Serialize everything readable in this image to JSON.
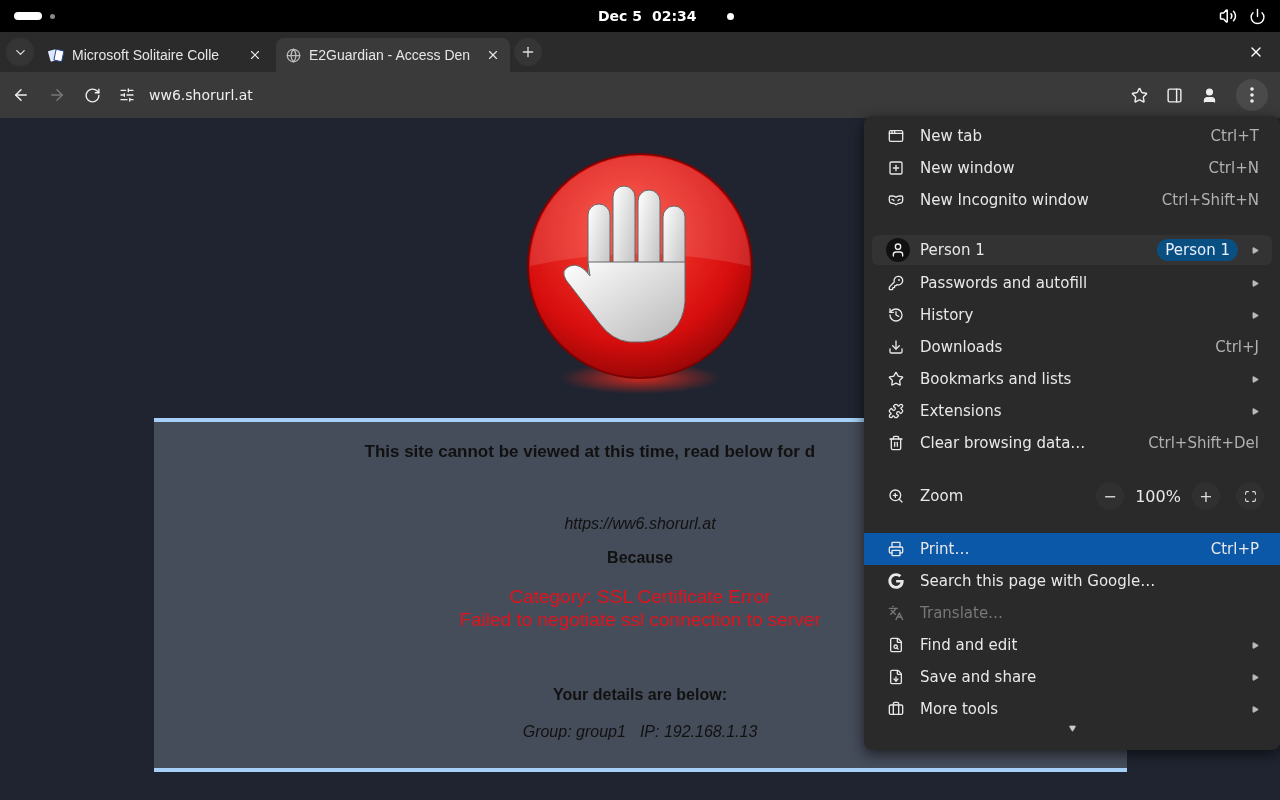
{
  "top_bar": {
    "date": "Dec 5",
    "time": "02:34"
  },
  "tabs": [
    {
      "title": "Microsoft Solitaire Colle",
      "selected": false
    },
    {
      "title": "E2Guardian - Access Den",
      "selected": true
    }
  ],
  "toolbar": {
    "url": "ww6.shorurl.at",
    "forward_disabled": true
  },
  "page": {
    "heading": "This site cannot be viewed at this time, read below for d",
    "url": "https://ww6.shorurl.at",
    "because": "Because",
    "reasons": [
      "Category: SSL Certificate Error",
      "Failed to negotiate ssl connection to server"
    ],
    "details_heading": "Your details are below:",
    "group": "Group: group1",
    "ip": "IP: 192.168.1.13"
  },
  "menu": {
    "items": [
      {
        "kind": "item",
        "label": "New tab",
        "shortcut": "Ctrl+T",
        "submenu": false,
        "highlighted": false,
        "disabled": false
      },
      {
        "kind": "item",
        "label": "New window",
        "shortcut": "Ctrl+N",
        "submenu": false,
        "highlighted": false,
        "disabled": false
      },
      {
        "kind": "item",
        "label": "New Incognito window",
        "shortcut": "Ctrl+Shift+N",
        "submenu": false,
        "highlighted": false,
        "disabled": false
      },
      {
        "kind": "separator"
      },
      {
        "kind": "profile",
        "label": "Person 1",
        "badge": "Person 1",
        "submenu": true
      },
      {
        "kind": "item",
        "label": "Passwords and autofill",
        "submenu": true,
        "highlighted": false,
        "disabled": false
      },
      {
        "kind": "item",
        "label": "History",
        "submenu": true,
        "highlighted": false,
        "disabled": false
      },
      {
        "kind": "item",
        "label": "Downloads",
        "shortcut": "Ctrl+J",
        "submenu": false,
        "highlighted": false,
        "disabled": false
      },
      {
        "kind": "item",
        "label": "Bookmarks and lists",
        "submenu": true,
        "highlighted": false,
        "disabled": false
      },
      {
        "kind": "item",
        "label": "Extensions",
        "submenu": true,
        "highlighted": false,
        "disabled": false
      },
      {
        "kind": "item",
        "label": "Clear browsing data…",
        "shortcut": "Ctrl+Shift+Del",
        "submenu": false,
        "highlighted": false,
        "disabled": false
      },
      {
        "kind": "separator"
      },
      {
        "kind": "zoom",
        "label": "Zoom",
        "minus": "−",
        "value": "100%",
        "plus": "+"
      },
      {
        "kind": "separator"
      },
      {
        "kind": "item",
        "label": "Print…",
        "shortcut": "Ctrl+P",
        "submenu": false,
        "highlighted": true,
        "disabled": false
      },
      {
        "kind": "item",
        "label": "Search this page with Google…",
        "submenu": false,
        "highlighted": false,
        "disabled": false
      },
      {
        "kind": "item",
        "label": "Translate…",
        "submenu": false,
        "highlighted": false,
        "disabled": true
      },
      {
        "kind": "item",
        "label": "Find and edit",
        "submenu": true,
        "highlighted": false,
        "disabled": false
      },
      {
        "kind": "item",
        "label": "Save and share",
        "submenu": true,
        "highlighted": false,
        "disabled": false
      },
      {
        "kind": "item",
        "label": "More tools",
        "submenu": true,
        "highlighted": false,
        "disabled": false
      }
    ]
  }
}
